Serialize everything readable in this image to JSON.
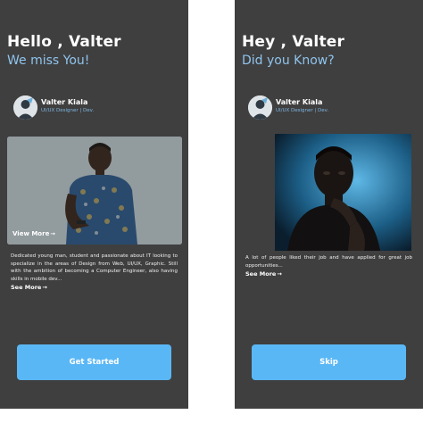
{
  "left": {
    "title": "Hello , Valter",
    "subtitle": "We miss You!",
    "profile": {
      "name": "Valter Kiala",
      "role": "UI/UX Designer | Dev."
    },
    "photo_link": "View More",
    "description": "Dedicated young man, student and passionate about IT looking to specialize in the areas of Design from Web, UI/UX, Graphic. Still with the ambition of becoming a Computer Engineer, also having skills in mobile dev...",
    "see_more": "See More",
    "cta": "Get Started"
  },
  "right": {
    "title": "Hey , Valter",
    "subtitle": "Did you Know?",
    "profile": {
      "name": "Valter Kiala",
      "role": "UI/UX Designer | Dev."
    },
    "description": "A lot of people liked their job and have applied for great job opportunities...",
    "see_more": "See More",
    "cta": "Skip"
  },
  "icons": {
    "arrow": "arrow-right-icon"
  },
  "colors": {
    "screen_bg": "#3f3f3f",
    "accent": "#5ab7f5",
    "subtitle": "#8fc4ee"
  }
}
